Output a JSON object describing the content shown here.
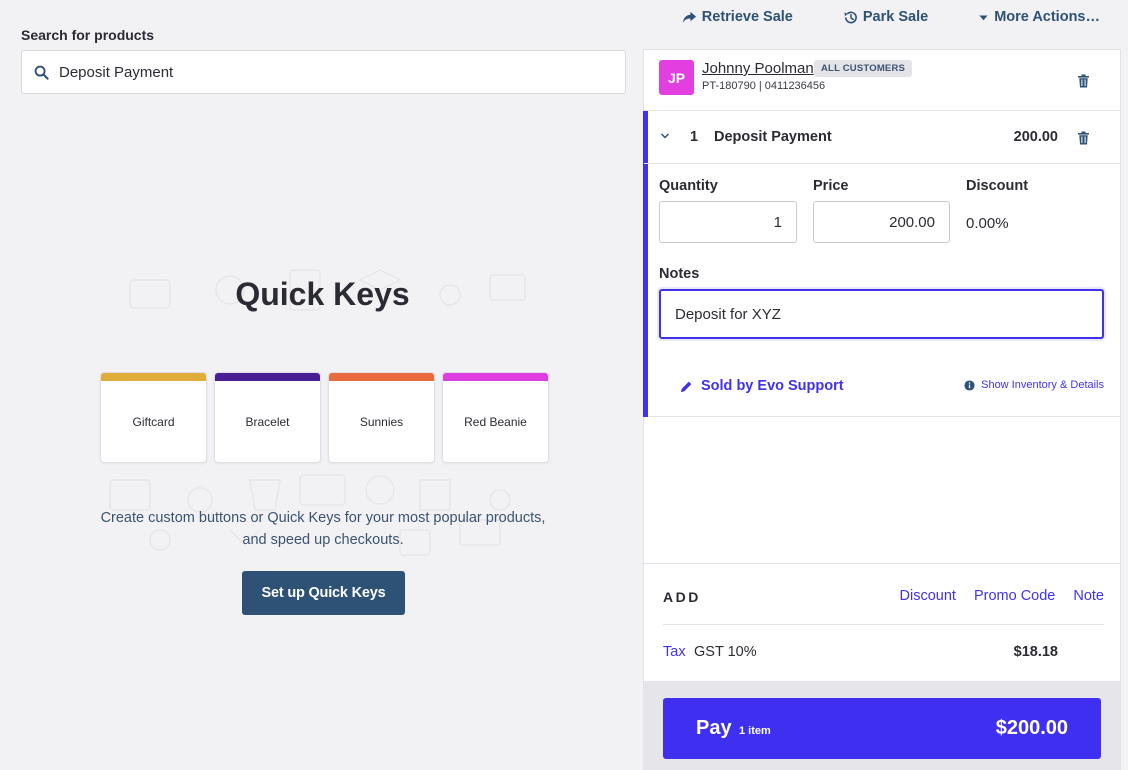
{
  "search": {
    "label": "Search for products",
    "value": "Deposit Payment"
  },
  "top_actions": [
    {
      "label": "Retrieve Sale",
      "icon": "share-arrow-icon"
    },
    {
      "label": "Park Sale",
      "icon": "history-icon"
    },
    {
      "label": "More Actions…",
      "icon": "caret-down-icon"
    }
  ],
  "quick_keys": {
    "title": "Quick Keys",
    "keys": [
      {
        "label": "Giftcard",
        "color": "#e0ad3a"
      },
      {
        "label": "Bracelet",
        "color": "#4a1f94"
      },
      {
        "label": "Sunnies",
        "color": "#e86a3e"
      },
      {
        "label": "Red Beanie",
        "color": "#dd3fe0"
      }
    ],
    "description": "Create custom buttons or Quick Keys for your most popular products, and speed up checkouts.",
    "setup_label": "Set up Quick Keys"
  },
  "customer": {
    "initials": "JP",
    "name": "Johnny Poolman",
    "tag": "ALL CUSTOMERS",
    "subline": "PT-180790 | 0411236456"
  },
  "line_item": {
    "quantity": "1",
    "name": "Deposit Payment",
    "price": "200.00",
    "fields": {
      "quantity_label": "Quantity",
      "quantity_value": "1",
      "price_label": "Price",
      "price_value": "200.00",
      "discount_label": "Discount",
      "discount_value": "0.00%",
      "notes_label": "Notes",
      "notes_value": "Deposit for XYZ"
    },
    "sold_by": "Sold by Evo Support",
    "show_inventory": "Show Inventory & Details"
  },
  "add": {
    "label": "ADD",
    "links": [
      "Discount",
      "Promo Code",
      "Note"
    ]
  },
  "tax": {
    "link": "Tax",
    "name": "GST 10%",
    "value": "$18.18"
  },
  "pay": {
    "label": "Pay",
    "items": "1 item",
    "total": "$200.00"
  },
  "colors": {
    "accent": "#4132e9",
    "nav": "#2e5276",
    "avatar": "#e33ee0"
  }
}
